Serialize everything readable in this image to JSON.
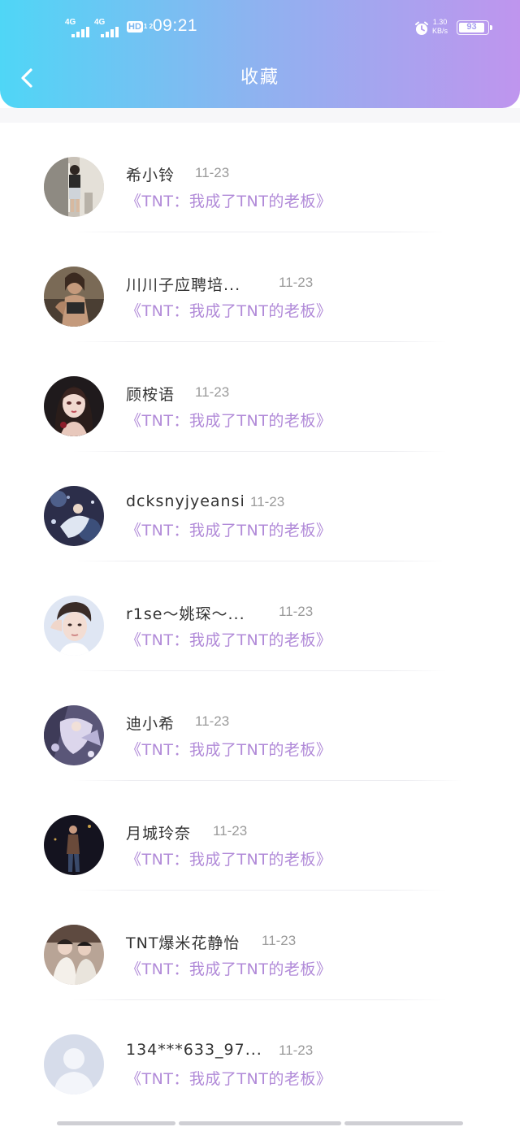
{
  "status_bar": {
    "signal_1": "4G",
    "signal_2": "4G",
    "hd_label": "HD",
    "hd_sub": "1 2",
    "time": "09:21",
    "speed_value": "1.30",
    "speed_unit": "KB/s",
    "battery": "93"
  },
  "header": {
    "title": "收藏"
  },
  "items": [
    {
      "user": "希小铃",
      "date": "11-23",
      "book": "《TNT：我成了TNT的老板》",
      "avatar": "photo-girl-mirror"
    },
    {
      "user": "川川子应聘培...",
      "date": "11-23",
      "book": "《TNT：我成了TNT的老板》",
      "avatar": "photo-woman-portrait"
    },
    {
      "user": "顾桉语",
      "date": "11-23",
      "book": "《TNT：我成了TNT的老板》",
      "avatar": "illustration-girl"
    },
    {
      "user": "dcksnyjyeansi",
      "date": "11-23",
      "book": "《TNT：我成了TNT的老板》",
      "avatar": "illustration-blue"
    },
    {
      "user": "r1se～姚琛～...",
      "date": "11-23",
      "book": "《TNT：我成了TNT的老板》",
      "avatar": "photo-boy"
    },
    {
      "user": "迪小希",
      "date": "11-23",
      "book": "《TNT：我成了TNT的老板》",
      "avatar": "illustration-purple"
    },
    {
      "user": "月城玲奈",
      "date": "11-23",
      "book": "《TNT：我成了TNT的老板》",
      "avatar": "photo-dark-figure"
    },
    {
      "user": "TNT爆米花静怡",
      "date": "11-23",
      "book": "《TNT：我成了TNT的老板》",
      "avatar": "photo-two-boys"
    },
    {
      "user": "134***633_97...",
      "date": "11-23",
      "book": "《TNT：我成了TNT的老板》",
      "avatar": "default-avatar"
    }
  ]
}
